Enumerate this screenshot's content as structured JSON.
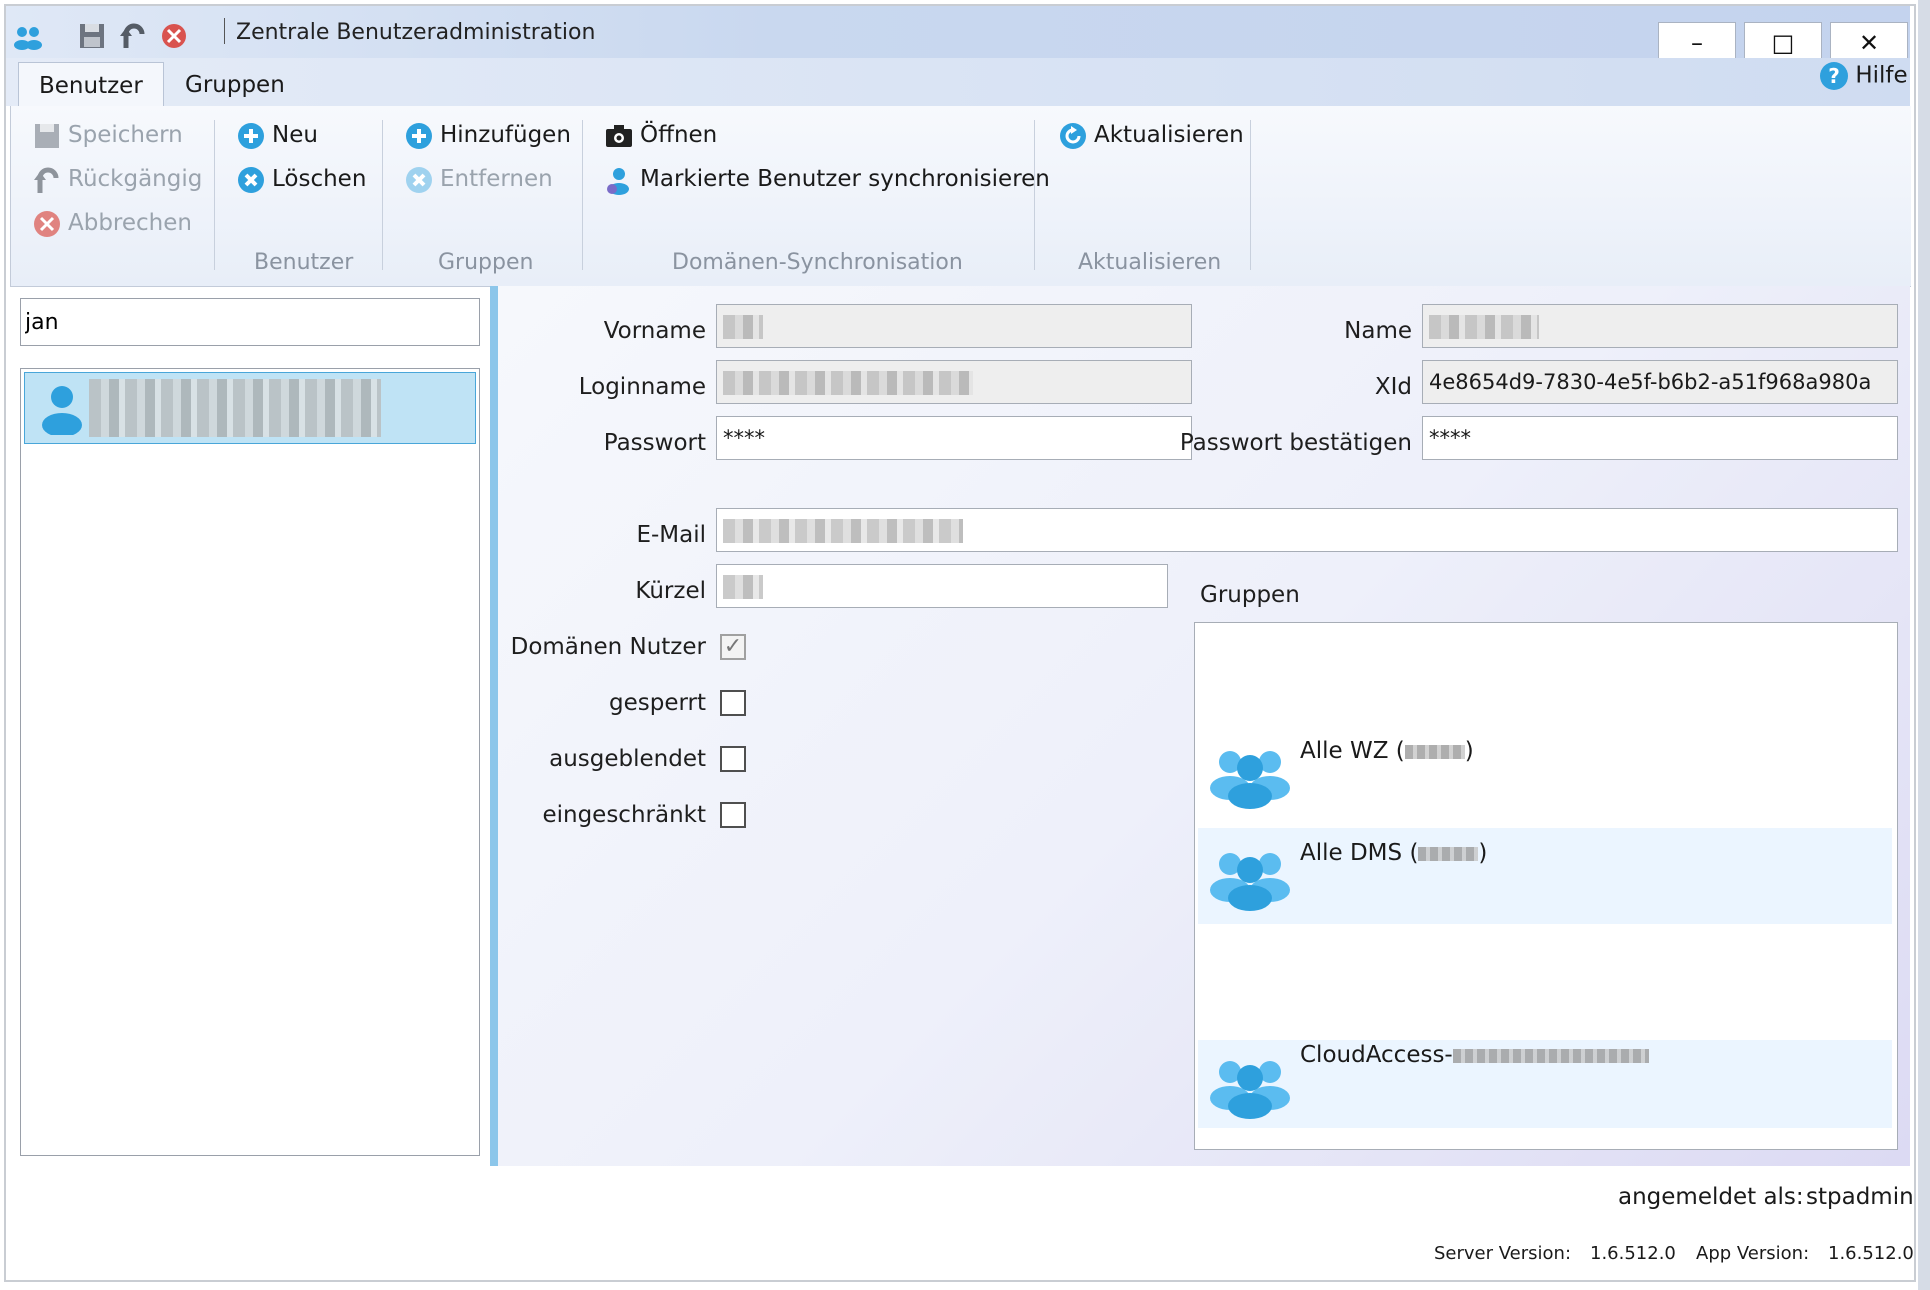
{
  "window": {
    "title": "Zentrale Benutzeradministration",
    "minimize": "–",
    "maximize": "□",
    "close": "✕"
  },
  "tabs": [
    {
      "label": "Benutzer",
      "active": true
    },
    {
      "label": "Gruppen",
      "active": false
    }
  ],
  "help": {
    "label": "Hilfe",
    "icon": "help-icon"
  },
  "ribbon": {
    "general": {
      "save": "Speichern",
      "undo": "Rückgängig",
      "cancel": "Abbrechen"
    },
    "benutzer": {
      "group_label": "Benutzer",
      "new": "Neu",
      "delete": "Löschen"
    },
    "gruppen": {
      "group_label": "Gruppen",
      "add": "Hinzufügen",
      "remove": "Entfernen"
    },
    "domain_sync": {
      "group_label": "Domänen-Synchronisation",
      "open": "Öffnen",
      "sync_marked": "Markierte Benutzer synchronisieren"
    },
    "refresh": {
      "group_label": "Aktualisieren",
      "refresh": "Aktualisieren"
    }
  },
  "search": {
    "value": "jan"
  },
  "user_list": {
    "items": [
      {
        "name": "",
        "selected": true
      }
    ]
  },
  "form": {
    "vorname_label": "Vorname",
    "name_label": "Name",
    "loginname_label": "Loginname",
    "xid_label": "XId",
    "xid_value": "4e8654d9-7830-4e5f-b6b2-a51f968a980a",
    "passwort_label": "Passwort",
    "passwort_value": "****",
    "passwort_confirm_label": "Passwort bestätigen",
    "passwort_confirm_value": "****",
    "email_label": "E-Mail",
    "kuerzel_label": "Kürzel",
    "domain_user_label": "Domänen Nutzer",
    "domain_user_checked": true,
    "gesperrt_label": "gesperrt",
    "gesperrt_checked": false,
    "ausgeblendet_label": "ausgeblendet",
    "ausgeblendet_checked": false,
    "eingeschraenkt_label": "eingeschränkt",
    "eingeschraenkt_checked": false,
    "check_mark": "✓"
  },
  "groups": {
    "label": "Gruppen",
    "items": [
      {
        "name": "Alle WZ (",
        "suffix": ")"
      },
      {
        "name": "Alle DMS (",
        "suffix": ")"
      },
      {
        "name": "CloudAccess-",
        "suffix": ""
      }
    ]
  },
  "status": {
    "logged_in_label": "angemeldet als:",
    "logged_in_user": "stpadmin",
    "server_version_label": "Server Version:",
    "server_version": "1.6.512.0",
    "app_version_label": "App Version:",
    "app_version": "1.6.512.0"
  },
  "colors": {
    "accent": "#49a6d9",
    "selection": "#bfe3f5",
    "group_alt_row": "#ebf5ff"
  }
}
